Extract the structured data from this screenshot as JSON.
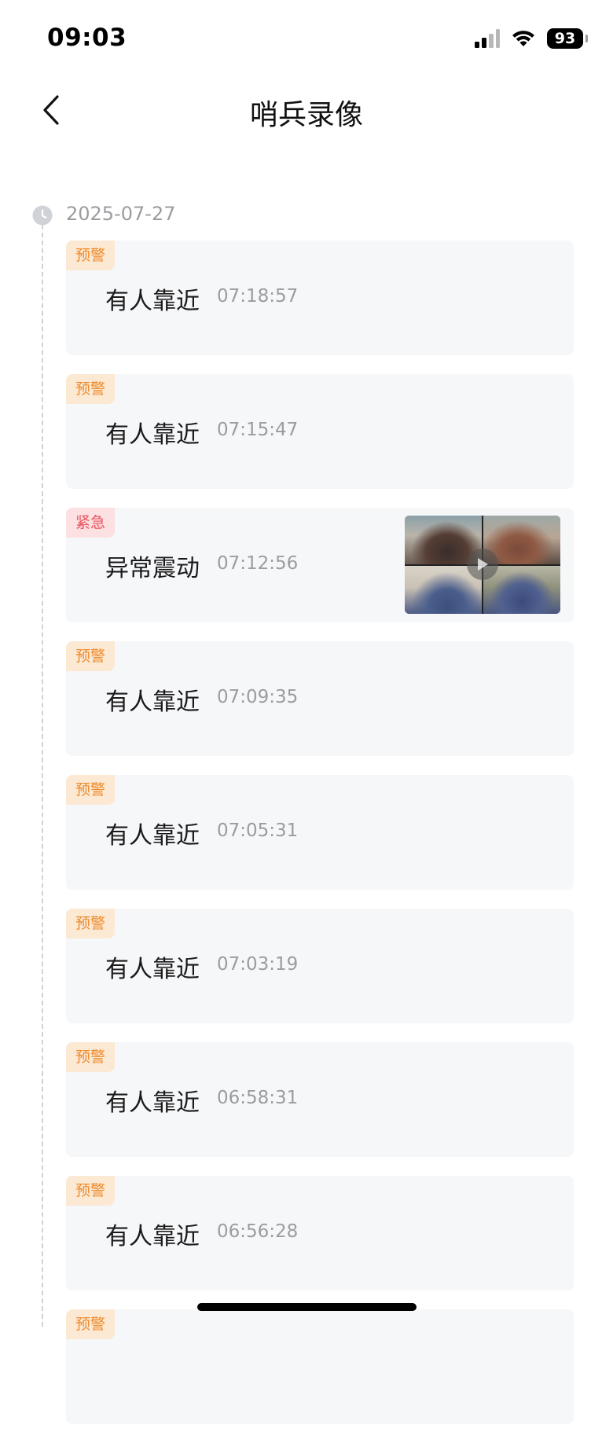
{
  "status_bar": {
    "time": "09:03",
    "battery": "93",
    "icons": [
      "signal-icon",
      "wifi-icon",
      "battery-icon"
    ]
  },
  "nav": {
    "title": "哨兵录像",
    "back_icon": "chevron-left-icon"
  },
  "timeline": {
    "date": "2025-07-27",
    "records": [
      {
        "tag": "预警",
        "level": "warning",
        "title": "有人靠近",
        "time": "07:18:57",
        "has_thumbnail": false
      },
      {
        "tag": "预警",
        "level": "warning",
        "title": "有人靠近",
        "time": "07:15:47",
        "has_thumbnail": false
      },
      {
        "tag": "紧急",
        "level": "urgent",
        "title": "异常震动",
        "time": "07:12:56",
        "has_thumbnail": true
      },
      {
        "tag": "预警",
        "level": "warning",
        "title": "有人靠近",
        "time": "07:09:35",
        "has_thumbnail": false
      },
      {
        "tag": "预警",
        "level": "warning",
        "title": "有人靠近",
        "time": "07:05:31",
        "has_thumbnail": false
      },
      {
        "tag": "预警",
        "level": "warning",
        "title": "有人靠近",
        "time": "07:03:19",
        "has_thumbnail": false
      },
      {
        "tag": "预警",
        "level": "warning",
        "title": "有人靠近",
        "time": "06:58:31",
        "has_thumbnail": false
      },
      {
        "tag": "预警",
        "level": "warning",
        "title": "有人靠近",
        "time": "06:56:28",
        "has_thumbnail": false
      },
      {
        "tag": "预警",
        "level": "warning",
        "title": "",
        "time": "",
        "has_thumbnail": false
      }
    ]
  },
  "colors": {
    "warning_text": "#ee8a2b",
    "warning_bg": "#fce9d4",
    "urgent_text": "#e9525c",
    "urgent_bg": "#fce0e2",
    "card_bg": "#f6f7f9",
    "muted_text": "#9a9ca0"
  }
}
